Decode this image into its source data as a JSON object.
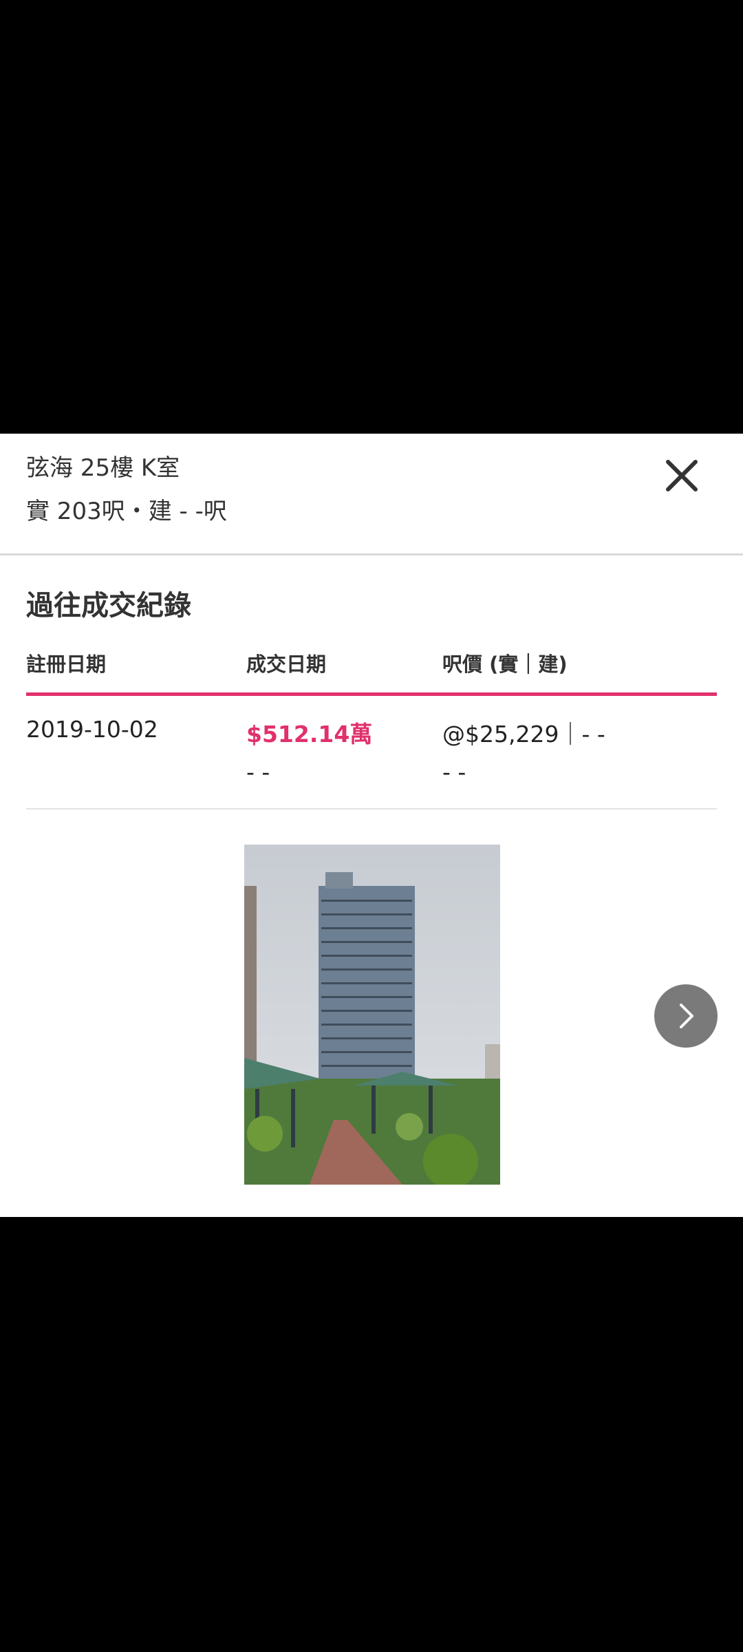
{
  "header": {
    "title": "弦海 25樓 K室",
    "subtitle": "實 203呎・建 - -呎"
  },
  "section": {
    "title": "過往成交紀錄"
  },
  "table": {
    "headers": [
      "註冊日期",
      "成交日期",
      "呎價 (實｜建)"
    ],
    "row": {
      "register_date": "2019-10-02",
      "price": "$512.14萬",
      "unit_price": "@$25,229｜- -",
      "deal_date": "- -",
      "build_price": "- -"
    }
  },
  "colors": {
    "accent": "#e1306c",
    "text": "#333333",
    "next_button": "#7a7a7a"
  },
  "icons": {
    "close": "close-icon",
    "next": "chevron-right-icon"
  }
}
